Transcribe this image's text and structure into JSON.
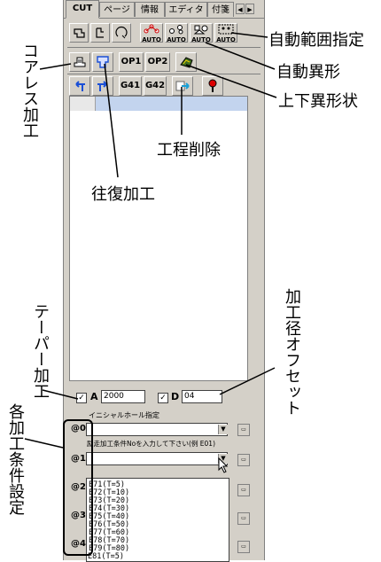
{
  "tabs": [
    {
      "label": "CUT",
      "active": true
    },
    {
      "label": "ページ",
      "active": false
    },
    {
      "label": "情報",
      "active": false
    },
    {
      "label": "エディタ",
      "active": false
    },
    {
      "label": "付箋",
      "active": false
    }
  ],
  "toolbar": {
    "row1_auto_labels": [
      "AUTO",
      "AUTO",
      "AUTO",
      "AUTO"
    ],
    "row2_buttons": [
      "OP1",
      "OP2"
    ],
    "row3_buttons": [
      "G41",
      "G42"
    ]
  },
  "fields": {
    "a_label": "A",
    "a_value": "2000",
    "d_label": "D",
    "d_value": "04",
    "initial_hole_label": "イニシャルホール指定",
    "cond_hint": "励走加工条件Noを入力して下さい(例 E01)"
  },
  "rows": [
    "@0",
    "@1",
    "@2",
    "@3",
    "@4"
  ],
  "dropdown_items": [
    "E71(T=5)",
    "E72(T=10)",
    "E73(T=20)",
    "E74(T=30)",
    "E75(T=40)",
    "E76(T=50)",
    "E77(T=60)",
    "E78(T=70)",
    "E79(T=80)",
    "E81(T=5)"
  ],
  "annotations": {
    "auto_range": "自動範囲指定",
    "auto_irregular": "自動異形",
    "top_bottom_irregular": "上下異形状",
    "corner_less": "コアレス加工",
    "process_delete": "工程削除",
    "reciprocating": "往復加工",
    "taper": "テーパー加工",
    "offset": "加工径オフセット",
    "conditions": "各加工条件設定"
  },
  "colors": {
    "panel": "#d4d0c8",
    "list_header": "#c3d4ee",
    "arrow_blue": "#1a4fd6"
  }
}
